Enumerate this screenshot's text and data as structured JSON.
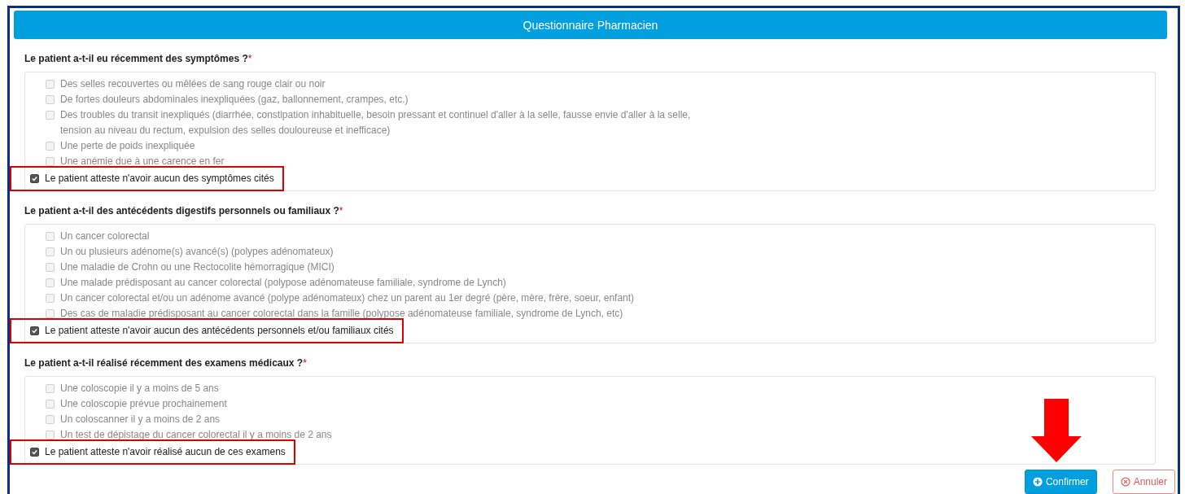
{
  "header": {
    "title": "Questionnaire Pharmacien"
  },
  "sections": [
    {
      "question": "Le patient a-t-il eu récemment des symptômes ?",
      "required_mark": "*",
      "options": [
        {
          "label": "Des selles recouvertes ou mêlées de sang rouge clair ou noir",
          "checked": false,
          "disabled": true
        },
        {
          "label": "De fortes douleurs abdominales inexpliquées (gaz, ballonnement, crampes, etc.)",
          "checked": false,
          "disabled": true
        },
        {
          "label": "Des troubles du transit inexpliqués (diarrhée, constipation inhabituelle, besoin pressant et continuel d'aller à la selle, fausse envie d'aller à la selle, tension au niveau du rectum, expulsion des selles douloureuse et inefficace)",
          "checked": false,
          "disabled": true
        },
        {
          "label": "Une perte de poids inexpliquée",
          "checked": false,
          "disabled": true
        },
        {
          "label": "Une anémie due à une carence en fer",
          "checked": false,
          "disabled": true
        }
      ],
      "attestation": {
        "label": "Le patient atteste n'avoir aucun des symptômes cités",
        "checked": true,
        "highlighted": true
      }
    },
    {
      "question": "Le patient a-t-il des antécédents digestifs personnels ou familiaux ?",
      "required_mark": "*",
      "options": [
        {
          "label": "Un cancer colorectal",
          "checked": false,
          "disabled": true
        },
        {
          "label": "Un ou plusieurs adénome(s) avancé(s) (polypes adénomateux)",
          "checked": false,
          "disabled": true
        },
        {
          "label": "Une maladie de Crohn ou une Rectocolite hémorragique (MICI)",
          "checked": false,
          "disabled": true
        },
        {
          "label": "Une malade prédisposant au cancer colorectal (polypose adénomateuse familiale, syndrome de Lynch)",
          "checked": false,
          "disabled": true
        },
        {
          "label": "Un cancer colorectal et/ou un adénome avancé (polype adénomateux) chez un parent au 1er degré (père, mère, frère, soeur, enfant)",
          "checked": false,
          "disabled": true
        },
        {
          "label": "Des cas de maladie prédisposant au cancer colorectal dans la famille (polypose adénomateuse familiale, syndrome de Lynch, etc)",
          "checked": false,
          "disabled": true
        }
      ],
      "attestation": {
        "label": "Le patient atteste n'avoir aucun des antécédents personnels et/ou familiaux cités",
        "checked": true,
        "highlighted": true
      }
    },
    {
      "question": "Le patient a-t-il réalisé récemment des examens médicaux ?",
      "required_mark": "*",
      "options": [
        {
          "label": "Une coloscopie il y a moins de 5 ans",
          "checked": false,
          "disabled": true
        },
        {
          "label": "Une coloscopie prévue prochainement",
          "checked": false,
          "disabled": true
        },
        {
          "label": "Un coloscanner il y a moins de 2 ans",
          "checked": false,
          "disabled": true
        },
        {
          "label": "Un test de dépistage du cancer colorectal il y a moins de 2 ans",
          "checked": false,
          "disabled": true
        }
      ],
      "attestation": {
        "label": "Le patient atteste n'avoir réalisé aucun de ces examens",
        "checked": true,
        "highlighted": true
      }
    }
  ],
  "buttons": [
    {
      "label": "Confirmer",
      "kind": "confirm"
    },
    {
      "label": "Annuler",
      "kind": "cancel"
    }
  ]
}
